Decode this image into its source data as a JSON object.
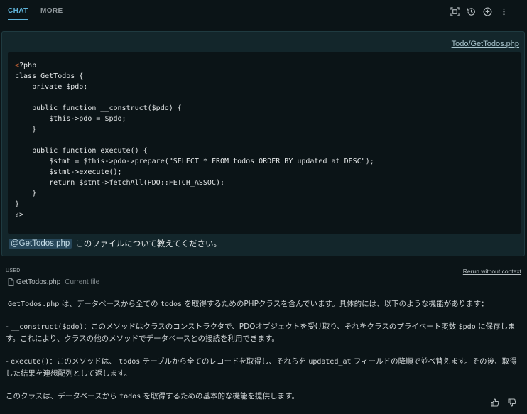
{
  "tabs": {
    "chat": "CHAT",
    "more": "MORE"
  },
  "toolbar": {
    "icons": [
      "expand-icon",
      "history-icon",
      "new-chat-icon",
      "more-icon"
    ]
  },
  "message": {
    "file_link": "Todo/GetTodos.php",
    "code": "<?php\nclass GetTodos {\n    private $pdo;\n\n    public function __construct($pdo) {\n        $this->pdo = $pdo;\n    }\n\n    public function execute() {\n        $stmt = $this->pdo->prepare(\"SELECT * FROM todos ORDER BY updated_at DESC\");\n        $stmt->execute();\n        return $stmt->fetchAll(PDO::FETCH_ASSOC);\n    }\n}\n?>",
    "mention": "@GetTodos.php",
    "prompt": "このファイルについて教えてください。"
  },
  "context": {
    "used_label": "USED",
    "rerun_label": "Rerun without context",
    "file_name": "GetTodos.php",
    "file_tag": "Current file"
  },
  "answer": {
    "p1_code": "GetTodos.php",
    "p1_a": " は、データベースから全ての ",
    "p1_code2": "todos",
    "p1_b": " を取得するためのPHPクラスを含んでいます。具体的には、以下のような機能があります：",
    "p2_prefix": "- ",
    "p2_code": "__construct($pdo)",
    "p2_a": "：このメソッドはクラスのコンストラクタで、PDOオブジェクトを受け取り、それをクラスのプライベート変数 ",
    "p2_code2": "$pdo",
    "p2_b": " に保存します。これにより、クラスの他のメソッドでデータベースとの接続を利用できます。",
    "p3_prefix": "- ",
    "p3_code": "execute()",
    "p3_a": "：このメソッドは、 ",
    "p3_code2": "todos",
    "p3_b": " テーブルから全てのレコードを取得し、それらを ",
    "p3_code3": "updated_at",
    "p3_c": " フィールドの降順で並べ替えます。その後、取得した結果を連想配列として返します。",
    "p4_a": "このクラスは、データベースから ",
    "p4_code": "todos",
    "p4_b": " を取得するための基本的な機能を提供します。"
  }
}
